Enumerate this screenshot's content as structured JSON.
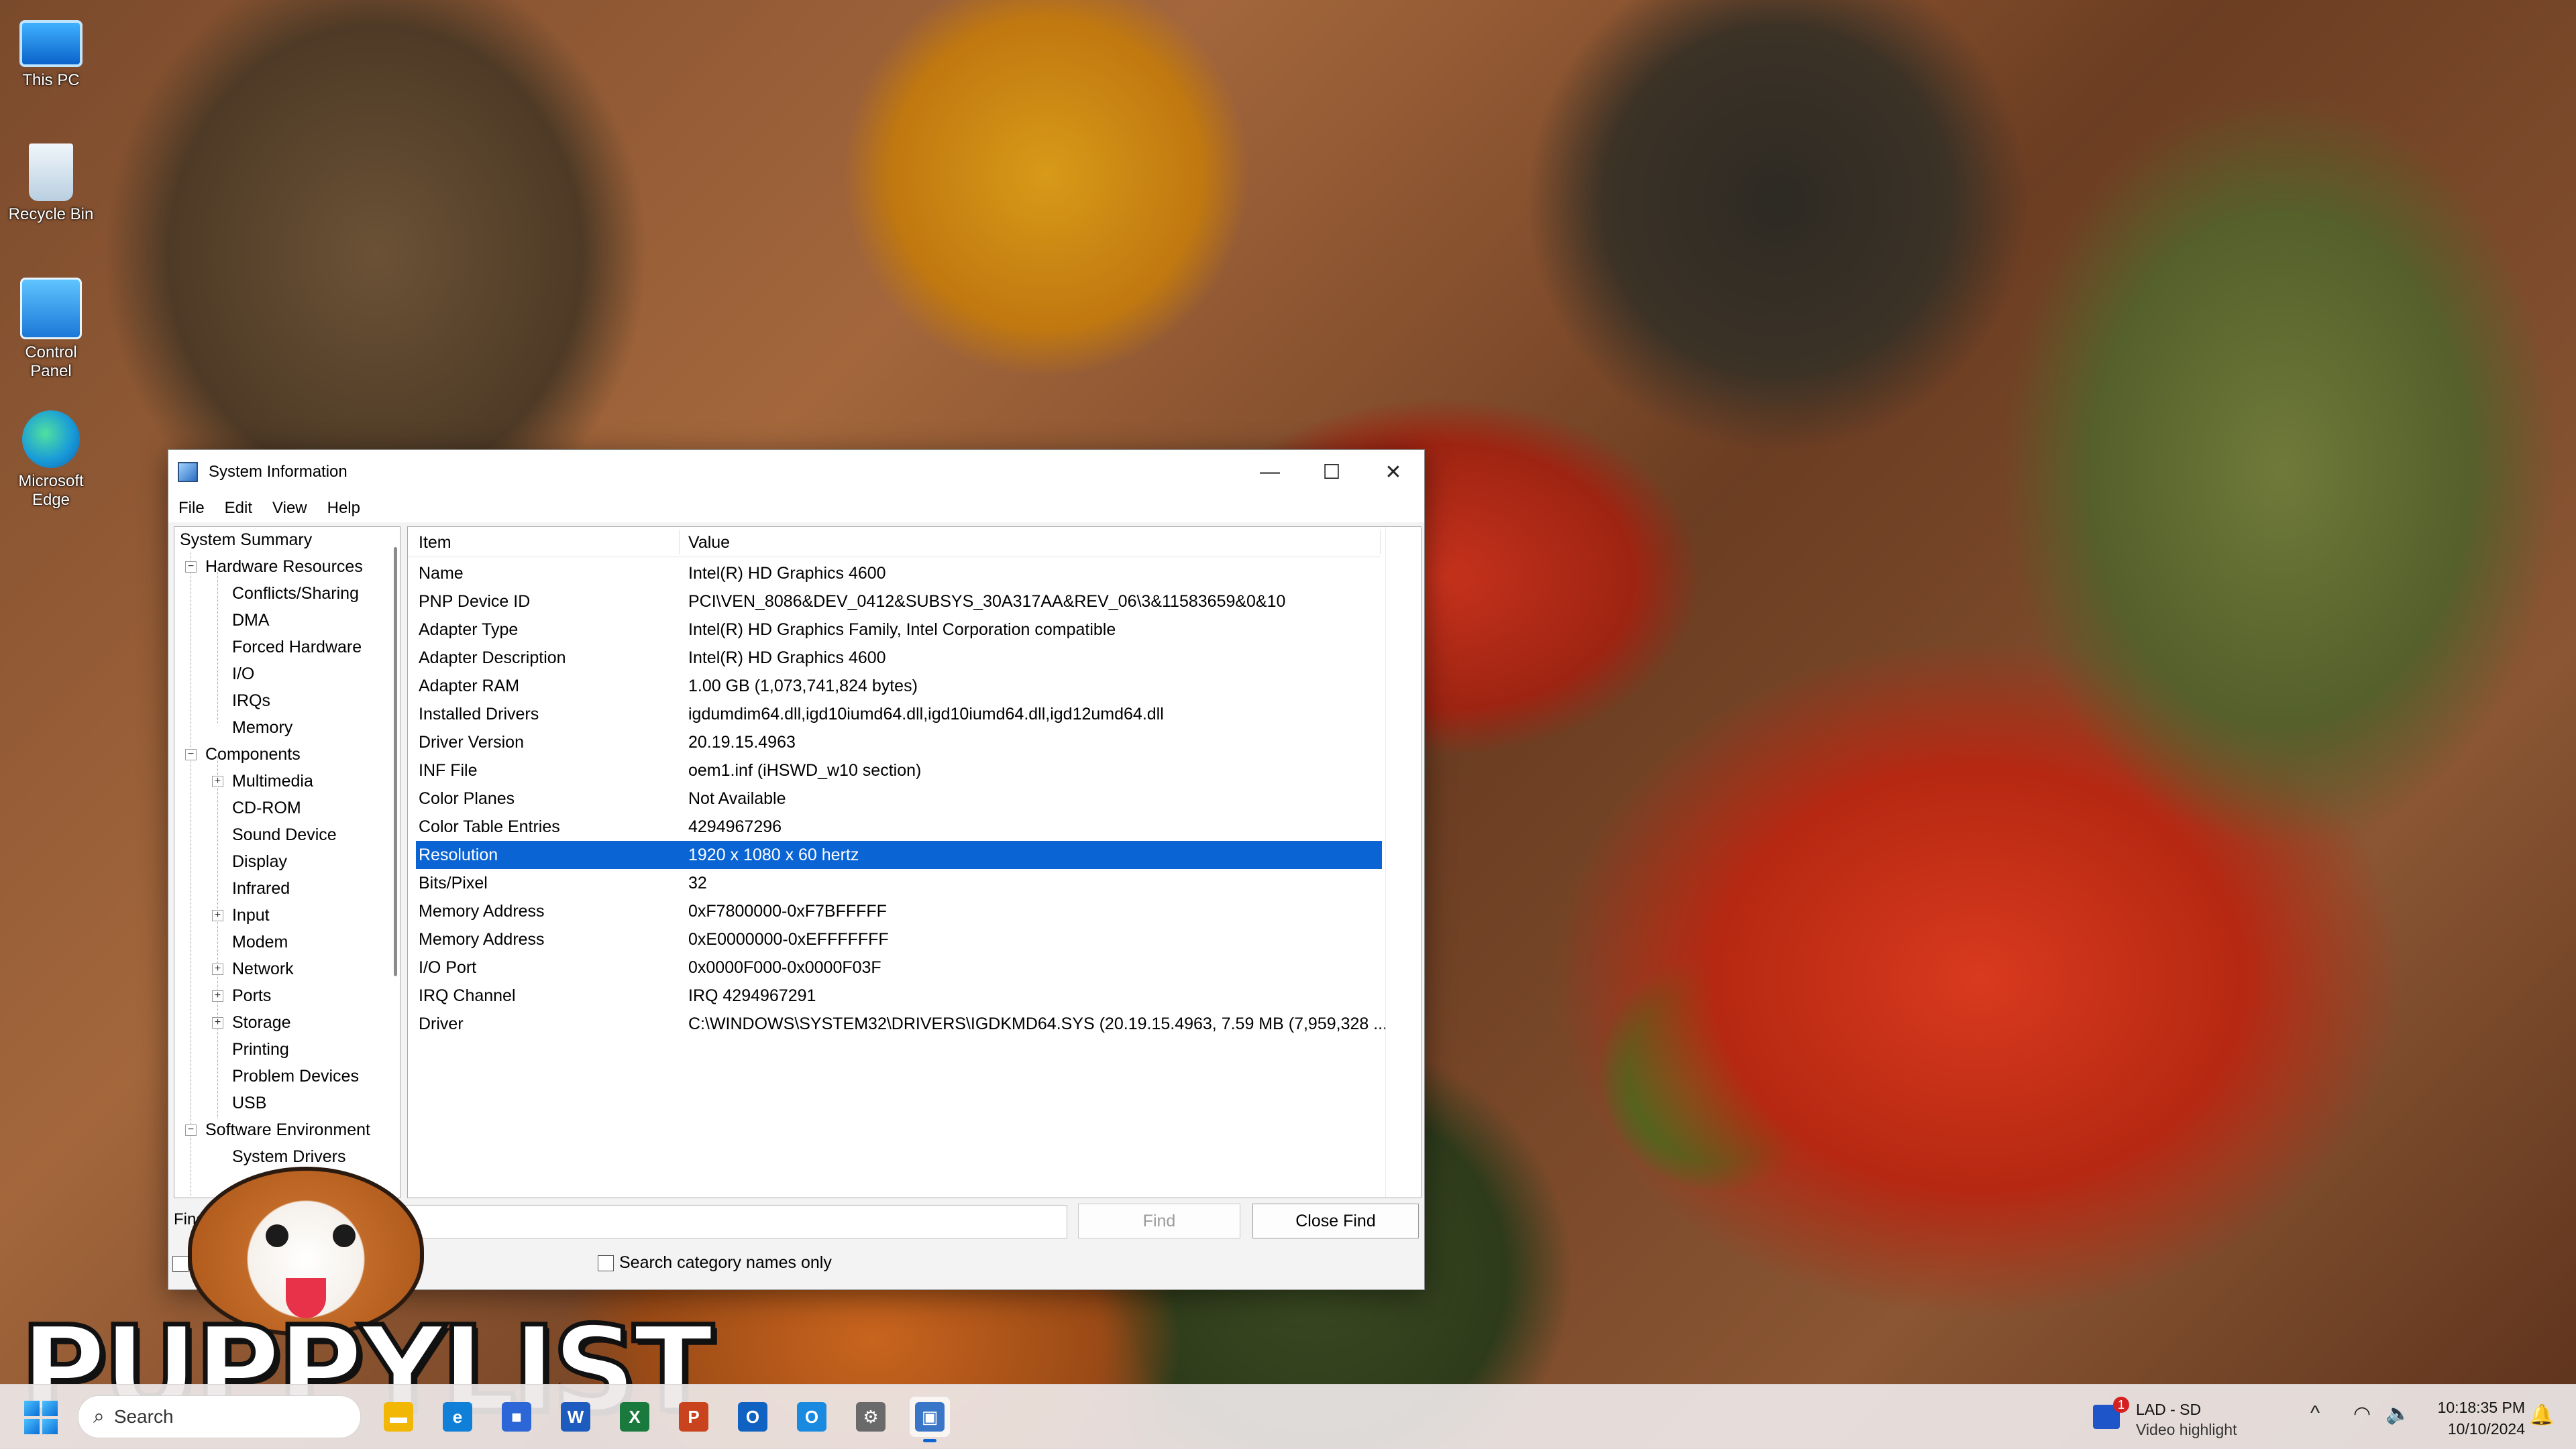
{
  "desktop": {
    "icons": [
      {
        "label": "This PC"
      },
      {
        "label": "Recycle Bin"
      },
      {
        "label": "Control Panel"
      },
      {
        "label": "Microsoft Edge"
      }
    ]
  },
  "window": {
    "title": "System Information",
    "controls": {
      "minimize": "—",
      "maximize": "☐",
      "close": "✕"
    },
    "menu": [
      "File",
      "Edit",
      "View",
      "Help"
    ],
    "tree": {
      "root": "System Summary",
      "hardware": {
        "label": "Hardware Resources",
        "expander": "−",
        "children": [
          "Conflicts/Sharing",
          "DMA",
          "Forced Hardware",
          "I/O",
          "IRQs",
          "Memory"
        ]
      },
      "components": {
        "label": "Components",
        "expander": "−",
        "children": [
          {
            "label": "Multimedia",
            "expander": "+"
          },
          {
            "label": "CD-ROM"
          },
          {
            "label": "Sound Device"
          },
          {
            "label": "Display"
          },
          {
            "label": "Infrared"
          },
          {
            "label": "Input",
            "expander": "+"
          },
          {
            "label": "Modem"
          },
          {
            "label": "Network",
            "expander": "+"
          },
          {
            "label": "Ports",
            "expander": "+"
          },
          {
            "label": "Storage",
            "expander": "+"
          },
          {
            "label": "Printing"
          },
          {
            "label": "Problem Devices"
          },
          {
            "label": "USB"
          }
        ]
      },
      "software": {
        "label": "Software Environment",
        "expander": "−",
        "children": [
          "System Drivers"
        ]
      }
    },
    "details": {
      "columns": {
        "item": "Item",
        "value": "Value"
      },
      "rows": [
        {
          "item": "Name",
          "value": "Intel(R) HD Graphics 4600"
        },
        {
          "item": "PNP Device ID",
          "value": "PCI\\VEN_8086&DEV_0412&SUBSYS_30A317AA&REV_06\\3&11583659&0&10"
        },
        {
          "item": "Adapter Type",
          "value": "Intel(R) HD Graphics Family, Intel Corporation compatible"
        },
        {
          "item": "Adapter Description",
          "value": "Intel(R) HD Graphics 4600"
        },
        {
          "item": "Adapter RAM",
          "value": "1.00 GB (1,073,741,824 bytes)"
        },
        {
          "item": "Installed Drivers",
          "value": "igdumdim64.dll,igd10iumd64.dll,igd10iumd64.dll,igd12umd64.dll"
        },
        {
          "item": "Driver Version",
          "value": "20.19.15.4963"
        },
        {
          "item": "INF File",
          "value": "oem1.inf (iHSWD_w10 section)"
        },
        {
          "item": "Color Planes",
          "value": "Not Available"
        },
        {
          "item": "Color Table Entries",
          "value": "4294967296"
        },
        {
          "item": "Resolution",
          "value": "1920 x 1080 x 60 hertz",
          "selected": true
        },
        {
          "item": "Bits/Pixel",
          "value": "32"
        },
        {
          "item": "Memory Address",
          "value": "0xF7800000-0xF7BFFFFF"
        },
        {
          "item": "Memory Address",
          "value": "0xE0000000-0xEFFFFFFF"
        },
        {
          "item": "I/O Port",
          "value": "0x0000F000-0x0000F03F"
        },
        {
          "item": "IRQ Channel",
          "value": "IRQ 4294967291"
        },
        {
          "item": "Driver",
          "value": "C:\\WINDOWS\\SYSTEM32\\DRIVERS\\IGDKMD64.SYS (20.19.15.4963, 7.59 MB (7,959,328 ..."
        }
      ]
    },
    "find": {
      "label": "Find",
      "value": "",
      "find_button": "Find",
      "close_button": "Close Find",
      "category_only_label": "Search category names only"
    }
  },
  "overlay": {
    "logo_text": "PUPPYLIST"
  },
  "taskbar": {
    "search_placeholder": "Search",
    "apps": [
      {
        "name": "file-explorer",
        "glyph": "▬",
        "color": "#f2b705"
      },
      {
        "name": "edge",
        "glyph": "e",
        "color": "#0f7fd8"
      },
      {
        "name": "store",
        "glyph": "■",
        "color": "#2d66d6"
      },
      {
        "name": "word",
        "glyph": "W",
        "color": "#1d5bbf"
      },
      {
        "name": "excel",
        "glyph": "X",
        "color": "#1a7a3e"
      },
      {
        "name": "powerpoint",
        "glyph": "P",
        "color": "#c8431e"
      },
      {
        "name": "outlook",
        "glyph": "O",
        "color": "#0f62c2"
      },
      {
        "name": "outlook-new",
        "glyph": "O",
        "color": "#1a8ae0"
      },
      {
        "name": "settings",
        "glyph": "⚙",
        "color": "#6a6a6a"
      },
      {
        "name": "system-information",
        "glyph": "▣",
        "color": "#3a76c8",
        "active": true
      }
    ],
    "notification": {
      "badge": "1",
      "title": "LAD - SD",
      "subtitle": "Video highlight"
    },
    "tray": {
      "chevron": "^",
      "wifi": "◠",
      "volume": "🔈"
    },
    "clock": {
      "time": "10:18:35 PM",
      "date": "10/10/2024"
    }
  },
  "colors": {
    "selection": "#0a64d4",
    "accent": "#0a64d4"
  }
}
